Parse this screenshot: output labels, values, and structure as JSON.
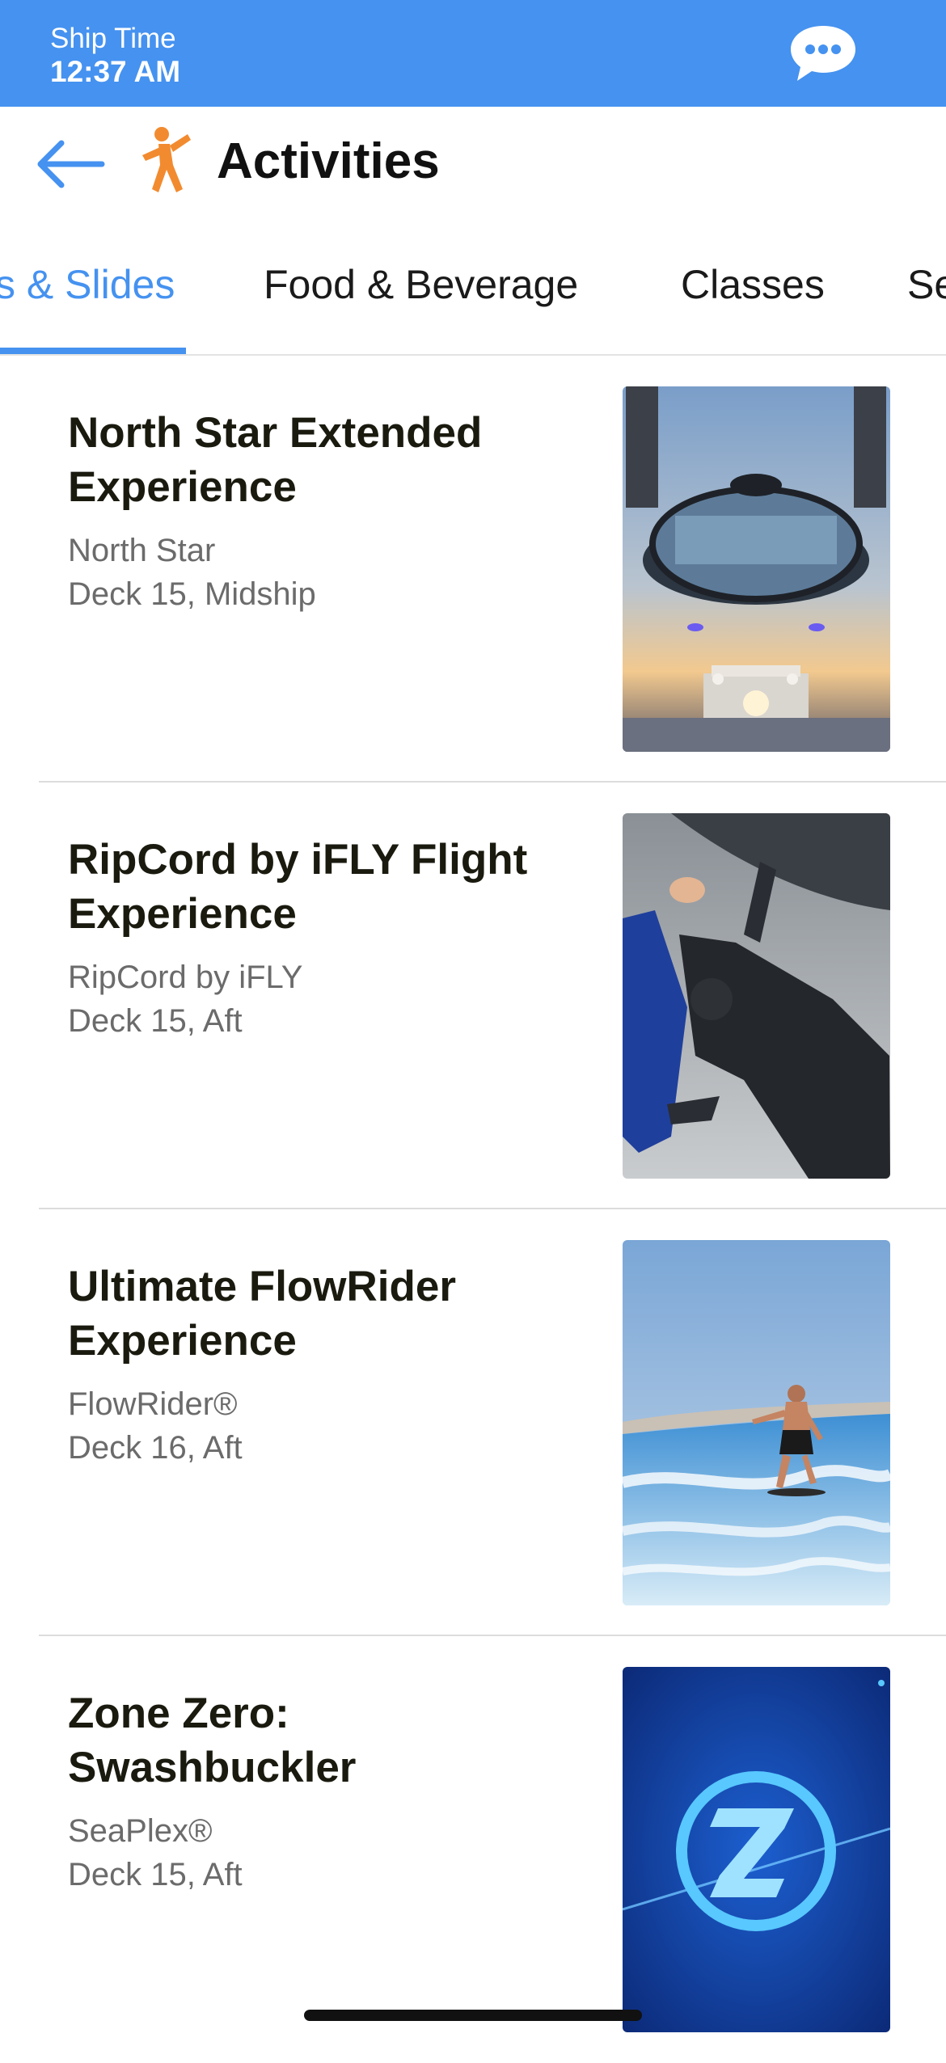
{
  "status_bar": {
    "ship_time_label": "Ship Time",
    "ship_time_value": "12:37 AM",
    "chat_icon": "chat-bubble-icon",
    "background_color": "#4592f0"
  },
  "header": {
    "back_icon": "back-arrow-icon",
    "activity_icon": "person-running-icon",
    "title": "Activities"
  },
  "tabs": {
    "items": [
      {
        "label": "s & Slides",
        "active": true
      },
      {
        "label": "Food & Beverage",
        "active": false
      },
      {
        "label": "Classes",
        "active": false
      },
      {
        "label": "Se",
        "active": false
      }
    ],
    "accent_color": "#4592f0"
  },
  "activities": [
    {
      "title": "North Star Extended Experience",
      "venue": "North Star",
      "deck": "Deck 15, Midship",
      "image": "north-star-pod-photo"
    },
    {
      "title": "RipCord by iFLY Flight Experience",
      "venue": "RipCord by iFLY",
      "deck": "Deck 15, Aft",
      "image": "indoor-skydiving-photo"
    },
    {
      "title": "Ultimate FlowRider Experience",
      "venue": "FlowRider®",
      "deck": "Deck 16, Aft",
      "image": "flowrider-surfer-photo"
    },
    {
      "title": "Zone Zero: Swashbuckler",
      "venue": "SeaPlex®",
      "deck": "Deck 15, Aft",
      "image": "zone-zero-logo-image"
    }
  ]
}
